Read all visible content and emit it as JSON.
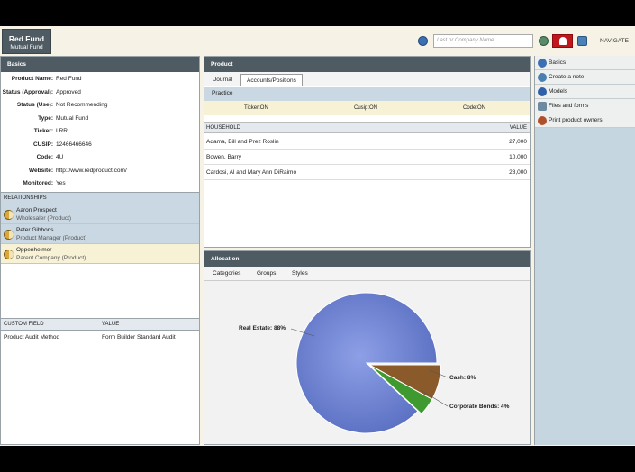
{
  "app": {
    "logo_title": "Red Fund",
    "logo_subtitle": "Mutual Fund",
    "search_placeholder": "Last or Company Name",
    "navigate_label": "NAVIGATE"
  },
  "basics": {
    "title": "Basics",
    "fields": [
      {
        "label": "Product Name:",
        "value": "Red Fund"
      },
      {
        "label": "Status (Approval):",
        "value": "Approved"
      },
      {
        "label": "Status (Use):",
        "value": "Not Recommending"
      },
      {
        "label": "Type:",
        "value": "Mutual Fund"
      },
      {
        "label": "Ticker:",
        "value": "LRR"
      },
      {
        "label": "CUSIP:",
        "value": "12466466646"
      },
      {
        "label": "Code:",
        "value": "4U"
      },
      {
        "label": "Website:",
        "value": "http://www.redproduct.com/"
      },
      {
        "label": "Monitored:",
        "value": "Yes"
      }
    ],
    "relationships_header": "RELATIONSHIPS",
    "relationships": [
      {
        "name": "Aaron Prospect",
        "role": "Wholesaler (Product)"
      },
      {
        "name": "Peter Gibbons",
        "role": "Product Manager (Product)"
      },
      {
        "name": "Oppenheimer",
        "role": "Parent Company (Product)"
      }
    ],
    "custom_field_header": "CUSTOM FIELD",
    "custom_value_header": "VALUE",
    "custom_fields": [
      {
        "field": "Product Audit Method",
        "value": "Form Builder Standard Audit"
      }
    ]
  },
  "product": {
    "title": "Product",
    "tabs": [
      "Journal",
      "Accounts/Positions"
    ],
    "practice_label": "Practice",
    "ticker_status": "Ticker:ON",
    "cusip_status": "Cusip:ON",
    "code_status": "Code:ON",
    "household_header": "HOUSEHOLD",
    "value_header": "VALUE",
    "households": [
      {
        "name": "Adama, Bill and Prez Roslin",
        "value": "27,000"
      },
      {
        "name": "Bowen, Barry",
        "value": "10,000"
      },
      {
        "name": "Cardosi, Al and Mary Ann DiRaimo",
        "value": "28,000"
      }
    ]
  },
  "allocation": {
    "title": "Allocation",
    "tabs": [
      "Categories",
      "Groups",
      "Styles"
    ]
  },
  "chart_data": {
    "type": "pie",
    "slices": [
      {
        "label": "Real Estate",
        "value": 88,
        "display": "Real Estate: 88%",
        "color": "#6f84d6"
      },
      {
        "label": "Cash",
        "value": 8,
        "display": "Cash: 8%",
        "color": "#8a5a2b"
      },
      {
        "label": "Corporate Bonds",
        "value": 4,
        "display": "Corporate Bonds: 4%",
        "color": "#3e9a2e"
      }
    ]
  },
  "nav": {
    "items": [
      "Basics",
      "Create a note",
      "Models",
      "Files and forms",
      "Print product owners"
    ]
  },
  "colors": {
    "header_dark": "#4f5b62",
    "alert_red": "#c0171d",
    "section_blue": "#c9d8e3",
    "highlight_yellow": "#f7f1d5"
  }
}
